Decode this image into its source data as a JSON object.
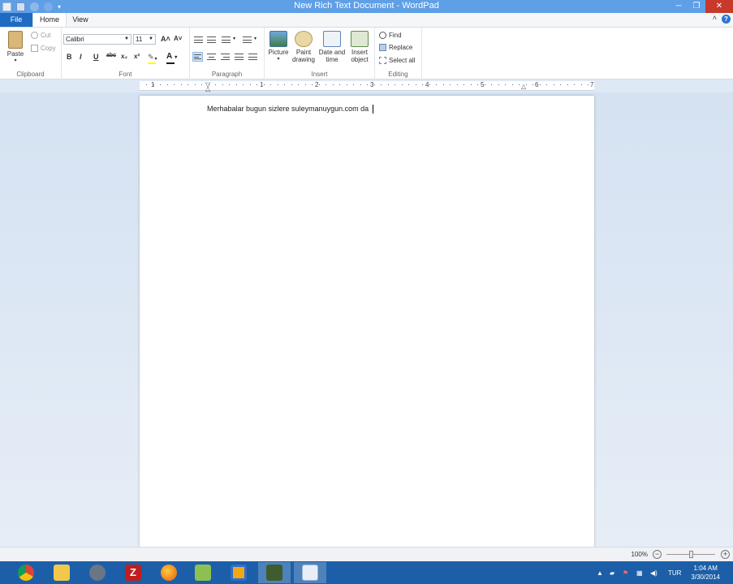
{
  "window": {
    "title": "New Rich Text Document - WordPad",
    "minimize": "─",
    "maximize": "❐",
    "close": "✕"
  },
  "ribbon_tabs": [
    "File",
    "Home",
    "View"
  ],
  "clipboard": {
    "paste": "Paste",
    "cut": "Cut",
    "copy": "Copy",
    "label": "Clipboard"
  },
  "font": {
    "family": "Calibri",
    "size": "11",
    "label": "Font",
    "bold": "B",
    "italic": "I",
    "underline": "U",
    "strike": "abc",
    "subscript": "x₂",
    "superscript": "x²",
    "grow": "A˄",
    "shrink": "A˅",
    "font_color": "#1f1f1f",
    "highlight_color": "#ffff00"
  },
  "paragraph": {
    "label": "Paragraph"
  },
  "insert": {
    "label": "Insert",
    "picture": "Picture",
    "paint_1": "Paint",
    "paint_2": "drawing",
    "date_1": "Date and",
    "date_2": "time",
    "object_1": "Insert",
    "object_2": "object"
  },
  "editing": {
    "label": "Editing",
    "find": "Find",
    "replace": "Replace",
    "select_all": "Select all"
  },
  "ruler": [
    "1",
    "1",
    "2",
    "3",
    "4",
    "5",
    "6",
    "7"
  ],
  "document": {
    "text": "Merhabalar bugun sizlere suleymanuygun.com da"
  },
  "status": {
    "zoom": "100%",
    "zoom_out": "−",
    "zoom_in": "+"
  },
  "taskbar": {
    "language": "TUR",
    "time": "1:04 AM",
    "date": "3/30/2014",
    "apps": [
      "chrome-icon",
      "file-explorer-icon",
      "app-icon",
      "filezilla-icon",
      "firefox-icon",
      "app-icon",
      "app-icon",
      "app-icon",
      "wordpad-icon"
    ]
  },
  "colors": {
    "title_bar": "#5e9fe6",
    "file_tab": "#1f6bc4",
    "taskbar": "#1c5fa8",
    "close_button": "#c7392b"
  }
}
